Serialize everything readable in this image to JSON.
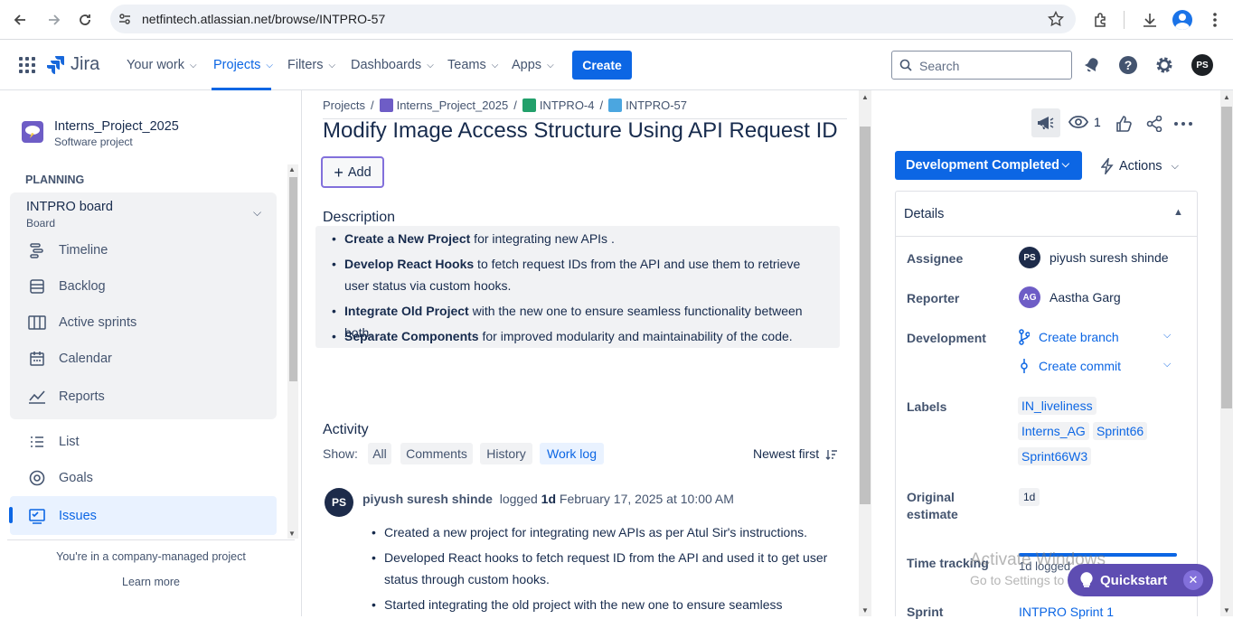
{
  "browser": {
    "url": "netfintech.atlassian.net/browse/INTPRO-57",
    "icons": [
      "back-icon",
      "forward-icon",
      "reload-icon",
      "site-info-icon",
      "star-icon",
      "extensions-icon",
      "download-icon",
      "profile-icon",
      "menu-icon"
    ]
  },
  "topnav": {
    "logo": "Jira",
    "items": [
      "Your work",
      "Projects",
      "Filters",
      "Dashboards",
      "Teams",
      "Apps"
    ],
    "create": "Create",
    "search_placeholder": "Search",
    "user_initials": "PS",
    "accent": "#0c66e4"
  },
  "sidebar": {
    "project_name": "Interns_Project_2025",
    "project_type": "Software project",
    "section": "PLANNING",
    "board_name": "INTPRO board",
    "board_sub": "Board",
    "planning_items": [
      "Timeline",
      "Backlog",
      "Active sprints",
      "Calendar",
      "Reports"
    ],
    "other_items": [
      "List",
      "Goals",
      "Issues"
    ],
    "footer": "You're in a company-managed project",
    "learn_more": "Learn more"
  },
  "breadcrumb": {
    "projects": "Projects",
    "project": "Interns_Project_2025",
    "parent": "INTPRO-4",
    "issue": "INTPRO-57"
  },
  "issue": {
    "title": "Modify Image Access Structure Using API Request ID",
    "add_label": "Add",
    "description_heading": "Description",
    "description": [
      {
        "bold": "Create a New Project",
        "text": " for integrating new APIs ."
      },
      {
        "bold": "Develop React Hooks",
        "text": " to fetch request IDs from the API and use them to retrieve user status via custom hooks."
      },
      {
        "bold": "Integrate Old Project",
        "text": " with the new one to ensure seamless functionality between both."
      },
      {
        "bold": "Separate Components",
        "text": " for improved modularity and maintainability of the code."
      }
    ]
  },
  "activity": {
    "heading": "Activity",
    "show_label": "Show:",
    "filters": [
      "All",
      "Comments",
      "History",
      "Work log"
    ],
    "active_filter": "Work log",
    "sort": "Newest first",
    "log": {
      "initials": "PS",
      "author": "piyush suresh shinde",
      "logged": "logged",
      "duration": "1d",
      "date": "February 17, 2025 at 10:00 AM",
      "items": [
        "Created a new project for integrating new APIs as per Atul Sir's instructions.",
        "Developed React hooks to fetch request ID from the API and used it to get user status through custom hooks.",
        "Started integrating the old project with the new one to ensure seamless"
      ]
    }
  },
  "right_panel": {
    "watch_count": "1",
    "status": "Development Completed",
    "actions": "Actions",
    "details_title": "Details",
    "assignee_label": "Assignee",
    "assignee": {
      "initials": "PS",
      "name": "piyush suresh shinde",
      "color": "#1d2b4a"
    },
    "reporter_label": "Reporter",
    "reporter": {
      "initials": "AG",
      "name": "Aastha Garg",
      "color": "#6e5dc6"
    },
    "development_label": "Development",
    "create_branch": "Create branch",
    "create_commit": "Create commit",
    "labels_label": "Labels",
    "labels": [
      "IN_liveliness",
      "Interns_AG",
      "Sprint66",
      "Sprint66W3"
    ],
    "estimate_label_1": "Original",
    "estimate_label_2": "estimate",
    "estimate": "1d",
    "time_tracking_label": "Time tracking",
    "time_logged": "1d logged",
    "sprint_label": "Sprint",
    "sprint": "INTPRO Sprint 1"
  },
  "quickstart": "Quickstart",
  "watermark": {
    "line1": "Activate Windows",
    "line2": "Go to Settings to activate Windows."
  }
}
